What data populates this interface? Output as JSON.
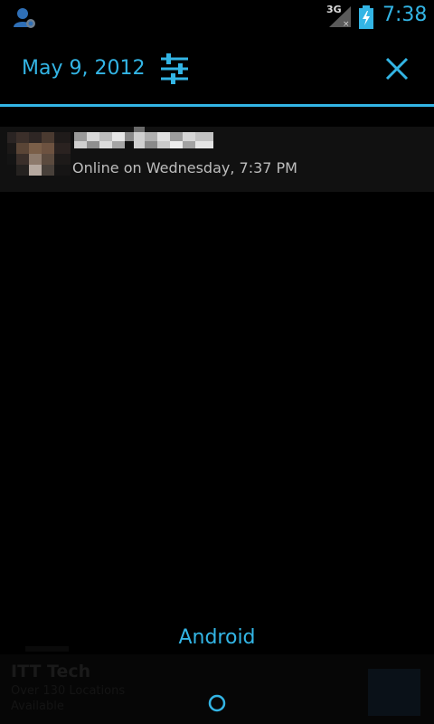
{
  "status_bar": {
    "network_type": "3G",
    "time": "7:38",
    "icons": [
      "contact-notification-icon",
      "signal-icon",
      "battery-charging-icon"
    ]
  },
  "header": {
    "date": "May 9, 2012",
    "settings_icon": "quick-settings-sliders-icon",
    "clear_icon": "close-icon"
  },
  "notification": {
    "text": "Online on Wednesday, 7:37 PM"
  },
  "carrier": {
    "label": "Android"
  },
  "ad": {
    "title": "ITT Tech",
    "subtitle_line1": "Over 130 Locations",
    "subtitle_line2": "Available"
  },
  "colors": {
    "accent": "#33b5e5",
    "background": "#000000",
    "row_background": "#111111",
    "secondary_text": "#bdbdbd"
  }
}
